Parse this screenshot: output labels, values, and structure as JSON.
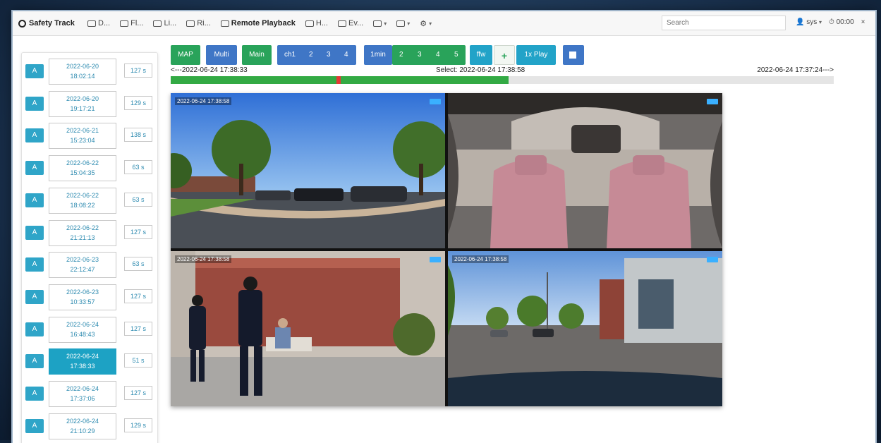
{
  "brand": {
    "name": "Safety Track"
  },
  "nav": [
    {
      "icon": "dashboard-icon",
      "label": "D..."
    },
    {
      "icon": "vehicle-icon",
      "label": "Fl..."
    },
    {
      "icon": "gps-icon",
      "label": "Li..."
    },
    {
      "icon": "video-icon",
      "label": "Ri..."
    },
    {
      "icon": "playback-icon",
      "label": "Remote Playback"
    },
    {
      "icon": "report-icon",
      "label": "H..."
    },
    {
      "icon": "list-icon",
      "label": "Ev..."
    },
    {
      "icon": "menu-icon",
      "label": ""
    },
    {
      "icon": "list-icon",
      "label": ""
    },
    {
      "icon": "settings-icon",
      "label": ""
    }
  ],
  "search": {
    "placeholder": "Search"
  },
  "user": {
    "account": "sys",
    "time": "00:00"
  },
  "controls": {
    "map": "MAP",
    "multi": "Multi",
    "main": "Main",
    "ch_label": "ch1",
    "ch2": "2",
    "ch3": "3",
    "ch4": "4",
    "speed_label": "1min",
    "s2": "2",
    "s3": "3",
    "s4": "4",
    "s5": "5",
    "ffw": "ffw",
    "plus": "+",
    "play": "1x Play"
  },
  "timeline": {
    "start": "<---2022-06-24 17:38:33",
    "select": "Select: 2022-06-24 17:38:58",
    "end": "2022-06-24 17:37:24--->",
    "progress": 0.51,
    "marker": 0.25
  },
  "recordings": [
    {
      "tag": "A",
      "date": "2022-06-20",
      "time": "18:02:14",
      "dur": "127 s"
    },
    {
      "tag": "A",
      "date": "2022-06-20",
      "time": "19:17:21",
      "dur": "129 s"
    },
    {
      "tag": "A",
      "date": "2022-06-21",
      "time": "15:23:04",
      "dur": "138 s"
    },
    {
      "tag": "A",
      "date": "2022-06-22",
      "time": "15:04:35",
      "dur": "63 s"
    },
    {
      "tag": "A",
      "date": "2022-06-22",
      "time": "18:08:22",
      "dur": "63 s"
    },
    {
      "tag": "A",
      "date": "2022-06-22",
      "time": "21:21:13",
      "dur": "127 s"
    },
    {
      "tag": "A",
      "date": "2022-06-23",
      "time": "22:12:47",
      "dur": "63 s"
    },
    {
      "tag": "A",
      "date": "2022-06-23",
      "time": "10:33:57",
      "dur": "127 s"
    },
    {
      "tag": "A",
      "date": "2022-06-24",
      "time": "16:48:43",
      "dur": "127 s"
    },
    {
      "tag": "A",
      "date": "2022-06-24",
      "time": "17:38:33",
      "dur": "51 s",
      "selected": true
    },
    {
      "tag": "A",
      "date": "2022-06-24",
      "time": "17:37:06",
      "dur": "127 s"
    },
    {
      "tag": "A",
      "date": "2022-06-24",
      "time": "21:10:29",
      "dur": "129 s"
    }
  ],
  "cameras": [
    {
      "osd": "2022-06-24 17:38:58",
      "scene": "parking-lot"
    },
    {
      "osd": "",
      "scene": "vehicle-interior"
    },
    {
      "osd": "2022-06-24 17:38:58",
      "scene": "police-officers"
    },
    {
      "osd": "2022-06-24 17:38:58",
      "scene": "street-view"
    }
  ]
}
